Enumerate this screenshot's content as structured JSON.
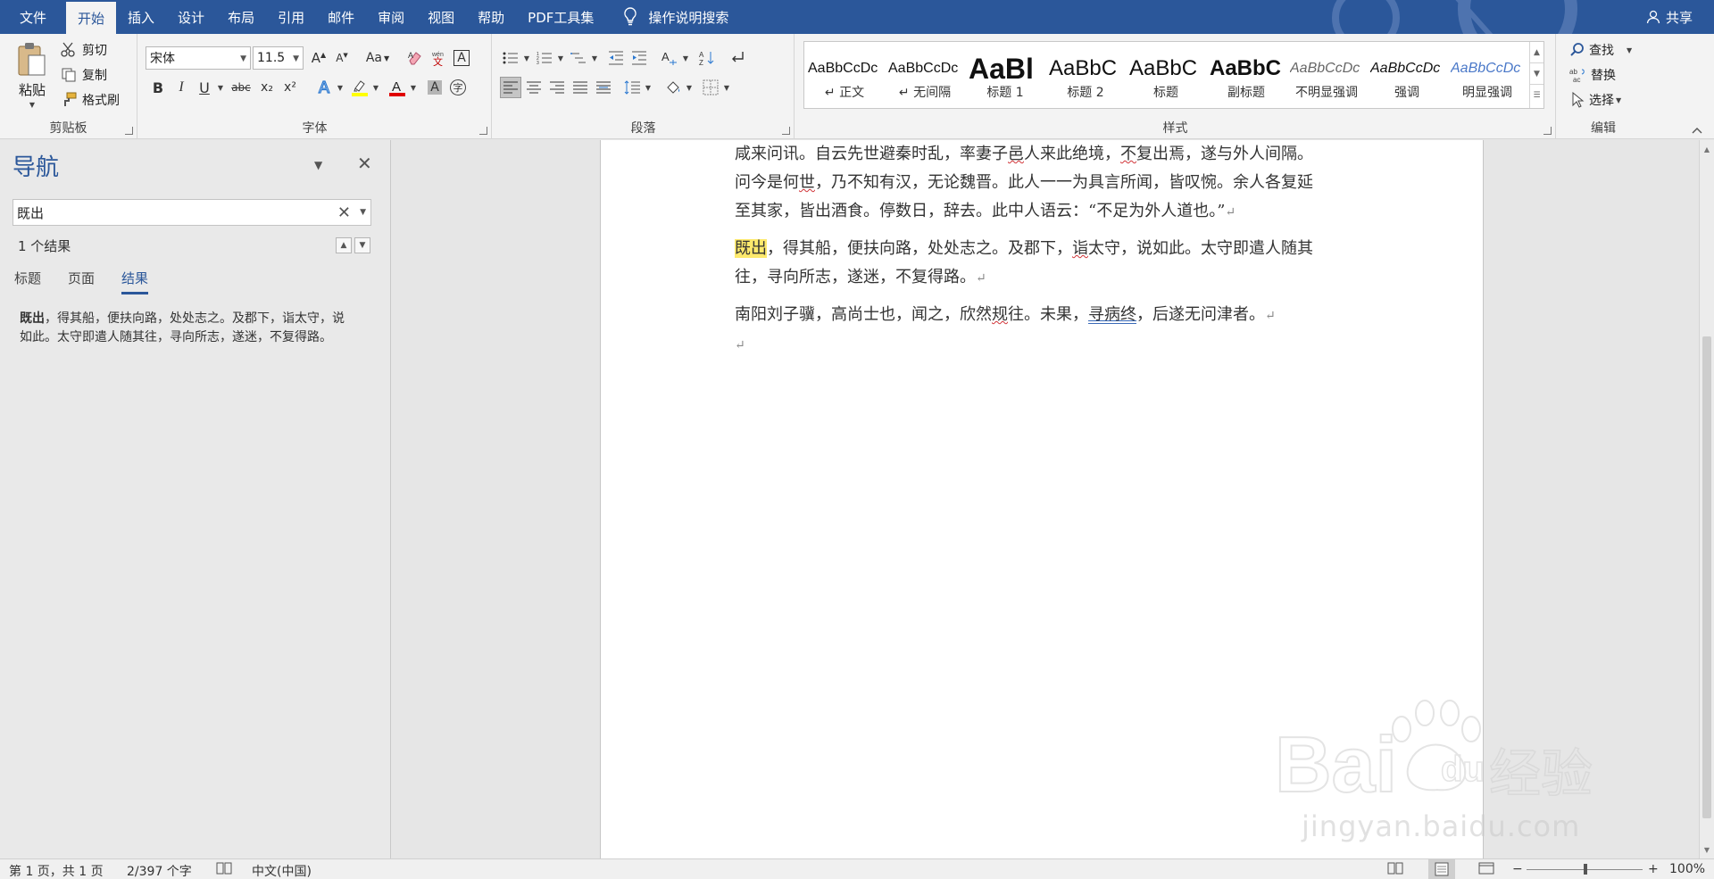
{
  "menu": {
    "tabs": [
      "文件",
      "开始",
      "插入",
      "设计",
      "布局",
      "引用",
      "邮件",
      "审阅",
      "视图",
      "帮助",
      "PDF工具集"
    ],
    "active_index": 1,
    "tell_me": "操作说明搜索",
    "share": "共享"
  },
  "ribbon": {
    "clipboard": {
      "label": "剪贴板",
      "paste": "粘贴",
      "cut": "剪切",
      "copy": "复制",
      "format_painter": "格式刷"
    },
    "font": {
      "label": "字体",
      "font_name": "宋体",
      "font_size": "11.5",
      "bold": "B",
      "italic": "I",
      "underline": "U",
      "strike": "abc",
      "subscript": "x₂",
      "superscript": "x²",
      "case": "Aa"
    },
    "paragraph": {
      "label": "段落"
    },
    "styles": {
      "label": "样式",
      "items": [
        {
          "preview": "AaBbCcDc",
          "name": "↵ 正文"
        },
        {
          "preview": "AaBbCcDc",
          "name": "↵ 无间隔"
        },
        {
          "preview": "AaBl",
          "name": "标题 1"
        },
        {
          "preview": "AaBbC",
          "name": "标题 2"
        },
        {
          "preview": "AaBbC",
          "name": "标题"
        },
        {
          "preview": "AaBbC",
          "name": "副标题"
        },
        {
          "preview": "AaBbCcDc",
          "name": "不明显强调"
        },
        {
          "preview": "AaBbCcDc",
          "name": "强调"
        },
        {
          "preview": "AaBbCcDc",
          "name": "明显强调"
        }
      ]
    },
    "editing": {
      "label": "编辑",
      "find": "查找",
      "replace": "替换",
      "select": "选择"
    }
  },
  "nav": {
    "title": "导航",
    "search_value": "既出",
    "result_count": "1 个结果",
    "subtabs": [
      "标题",
      "页面",
      "结果"
    ],
    "active_subtab": 2,
    "result": {
      "highlight": "既出",
      "text": "，得其船，便扶向路，处处志之。及郡下，诣太守，说如此。太守即遣人随其往，寻向所志，遂迷，不复得路。"
    }
  },
  "document": {
    "para1_line1": "咸来问讯。自云先世避秦时乱，率妻子邑人来此绝境，不复出焉，遂与外人间隔。",
    "para1_line2": "问今是何世，乃不知有汉，无论魏晋。此人一一为具言所闻，皆叹惋。余人各复延",
    "para1_line3": "至其家，皆出酒食。停数日，辞去。此中人语云：“不足为外人道也。”",
    "para2_highlight": "既出",
    "para2_line1_rest": "，得其船，便扶向路，处处志之。及郡下，诣太守，说如此。太守即遣人随其",
    "para2_line2": "往，寻向所志，遂迷，不复得路。",
    "para3": "南阳刘子骥，高尚士也，闻之，欣然规往。未果，寻病终，后遂无问津者。",
    "pilcrow": "↵"
  },
  "watermark": {
    "brand": "Bai",
    "brand2": "经验",
    "url": "jingyan.baidu.com"
  },
  "status": {
    "page": "第 1 页，共 1 页",
    "words": "2/397 个字",
    "language": "中文(中国)",
    "zoom": "100%",
    "zoom_minus": "−",
    "zoom_plus": "+"
  },
  "colors": {
    "accent": "#2b579a",
    "highlight": "#fde96c",
    "font_color_bar": "#e00000",
    "highlight_color_bar": "#ffff00"
  }
}
